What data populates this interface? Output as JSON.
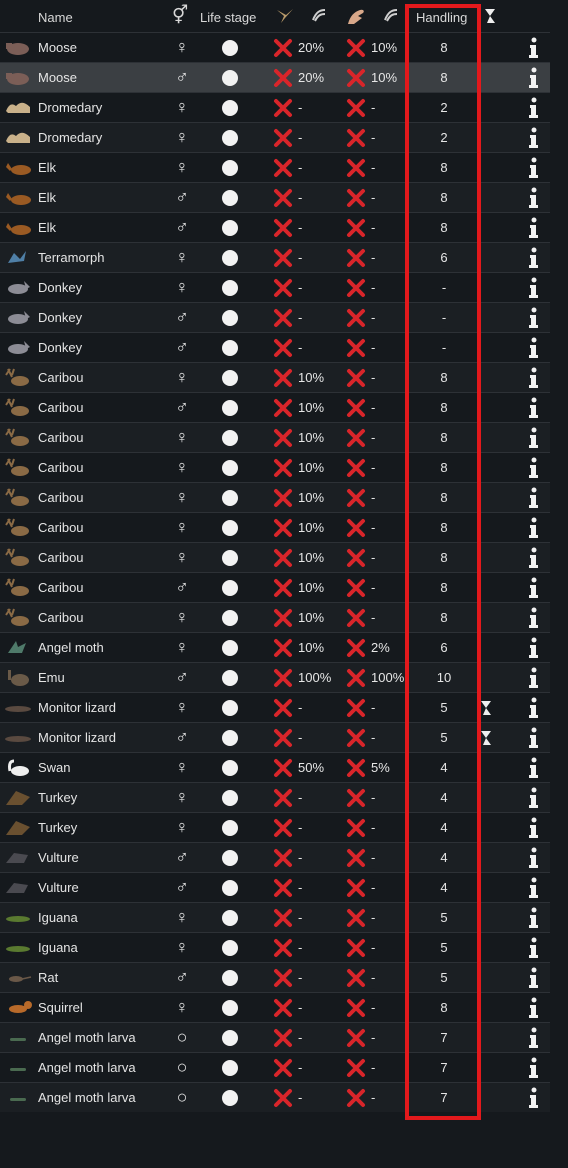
{
  "header": {
    "name": "Name",
    "gender_icon": "male-female-icon",
    "life_stage": "Life stage",
    "col1_icon": "pen-icon",
    "col1_sub_icon": "shearing-icon",
    "col2_icon": "hand-icon",
    "col2_sub_icon": "milking-icon",
    "handling": "Handling",
    "warn_icon": "bond-warning-icon"
  },
  "colors": {
    "x": "#d9252a",
    "highlight": "#e3191c",
    "selected_row": "#3b3f43"
  },
  "rows": [
    {
      "name": "Moose",
      "gender": "♀",
      "gender_icon": "female-icon",
      "life": "adult",
      "v1": "20%",
      "v2": "10%",
      "handling": "8",
      "warn": false,
      "animal": "moose-icon",
      "color": "#7b5e57"
    },
    {
      "name": "Moose",
      "gender": "♂",
      "gender_icon": "male-icon",
      "life": "adult",
      "v1": "20%",
      "v2": "10%",
      "handling": "8",
      "warn": false,
      "animal": "moose-icon",
      "color": "#7b5e57",
      "selected": true
    },
    {
      "name": "Dromedary",
      "gender": "♀",
      "gender_icon": "female-icon",
      "life": "adult",
      "v1": "-",
      "v2": "-",
      "handling": "2",
      "warn": false,
      "animal": "dromedary-icon",
      "color": "#c9b18a"
    },
    {
      "name": "Dromedary",
      "gender": "♀",
      "gender_icon": "female-icon",
      "life": "adult",
      "v1": "-",
      "v2": "-",
      "handling": "2",
      "warn": false,
      "animal": "dromedary-icon",
      "color": "#c9b18a"
    },
    {
      "name": "Elk",
      "gender": "♀",
      "gender_icon": "female-icon",
      "life": "adult",
      "v1": "-",
      "v2": "-",
      "handling": "8",
      "warn": false,
      "animal": "elk-icon",
      "color": "#9a5a23"
    },
    {
      "name": "Elk",
      "gender": "♂",
      "gender_icon": "male-icon",
      "life": "adult",
      "v1": "-",
      "v2": "-",
      "handling": "8",
      "warn": false,
      "animal": "elk-icon",
      "color": "#9a5a23"
    },
    {
      "name": "Elk",
      "gender": "♂",
      "gender_icon": "male-icon",
      "life": "adult",
      "v1": "-",
      "v2": "-",
      "handling": "8",
      "warn": false,
      "animal": "elk-icon",
      "color": "#9a5a23"
    },
    {
      "name": "Terramorph",
      "gender": "♀",
      "gender_icon": "female-icon",
      "life": "adult",
      "v1": "-",
      "v2": "-",
      "handling": "6",
      "warn": false,
      "animal": "terramorph-icon",
      "color": "#4f7fa6"
    },
    {
      "name": "Donkey",
      "gender": "♀",
      "gender_icon": "female-icon",
      "life": "adult",
      "v1": "-",
      "v2": "-",
      "handling": "-",
      "warn": false,
      "animal": "donkey-icon",
      "color": "#8c8c95"
    },
    {
      "name": "Donkey",
      "gender": "♂",
      "gender_icon": "male-icon",
      "life": "adult",
      "v1": "-",
      "v2": "-",
      "handling": "-",
      "warn": false,
      "animal": "donkey-icon",
      "color": "#8c8c95"
    },
    {
      "name": "Donkey",
      "gender": "♂",
      "gender_icon": "male-icon",
      "life": "adult",
      "v1": "-",
      "v2": "-",
      "handling": "-",
      "warn": false,
      "animal": "donkey-icon",
      "color": "#8c8c95"
    },
    {
      "name": "Caribou",
      "gender": "♀",
      "gender_icon": "female-icon",
      "life": "adult",
      "v1": "10%",
      "v2": "-",
      "handling": "8",
      "warn": false,
      "animal": "caribou-icon",
      "color": "#8a6a45"
    },
    {
      "name": "Caribou",
      "gender": "♂",
      "gender_icon": "male-icon",
      "life": "adult",
      "v1": "10%",
      "v2": "-",
      "handling": "8",
      "warn": false,
      "animal": "caribou-icon",
      "color": "#8a6a45"
    },
    {
      "name": "Caribou",
      "gender": "♀",
      "gender_icon": "female-icon",
      "life": "adult",
      "v1": "10%",
      "v2": "-",
      "handling": "8",
      "warn": false,
      "animal": "caribou-icon",
      "color": "#8a6a45"
    },
    {
      "name": "Caribou",
      "gender": "♀",
      "gender_icon": "female-icon",
      "life": "adult",
      "v1": "10%",
      "v2": "-",
      "handling": "8",
      "warn": false,
      "animal": "caribou-icon",
      "color": "#8a6a45"
    },
    {
      "name": "Caribou",
      "gender": "♀",
      "gender_icon": "female-icon",
      "life": "adult",
      "v1": "10%",
      "v2": "-",
      "handling": "8",
      "warn": false,
      "animal": "caribou-icon",
      "color": "#8a6a45"
    },
    {
      "name": "Caribou",
      "gender": "♀",
      "gender_icon": "female-icon",
      "life": "adult",
      "v1": "10%",
      "v2": "-",
      "handling": "8",
      "warn": false,
      "animal": "caribou-icon",
      "color": "#8a6a45"
    },
    {
      "name": "Caribou",
      "gender": "♀",
      "gender_icon": "female-icon",
      "life": "adult",
      "v1": "10%",
      "v2": "-",
      "handling": "8",
      "warn": false,
      "animal": "caribou-icon",
      "color": "#8a6a45"
    },
    {
      "name": "Caribou",
      "gender": "♂",
      "gender_icon": "male-icon",
      "life": "adult",
      "v1": "10%",
      "v2": "-",
      "handling": "8",
      "warn": false,
      "animal": "caribou-icon",
      "color": "#8a6a45"
    },
    {
      "name": "Caribou",
      "gender": "♀",
      "gender_icon": "female-icon",
      "life": "adult",
      "v1": "10%",
      "v2": "-",
      "handling": "8",
      "warn": false,
      "animal": "caribou-icon",
      "color": "#8a6a45"
    },
    {
      "name": "Angel moth",
      "gender": "♀",
      "gender_icon": "female-icon",
      "life": "adult",
      "v1": "10%",
      "v2": "2%",
      "handling": "6",
      "warn": false,
      "animal": "angel-moth-icon",
      "color": "#4f7a6a"
    },
    {
      "name": "Emu",
      "gender": "♂",
      "gender_icon": "male-icon",
      "life": "adult",
      "v1": "100%",
      "v2": "100%",
      "handling": "10",
      "warn": false,
      "animal": "emu-icon",
      "color": "#6a5a48"
    },
    {
      "name": "Monitor lizard",
      "gender": "♀",
      "gender_icon": "female-icon",
      "life": "adult",
      "v1": "-",
      "v2": "-",
      "handling": "5",
      "warn": true,
      "animal": "monitor-lizard-icon",
      "color": "#5a4a40"
    },
    {
      "name": "Monitor lizard",
      "gender": "♂",
      "gender_icon": "male-icon",
      "life": "adult",
      "v1": "-",
      "v2": "-",
      "handling": "5",
      "warn": true,
      "animal": "monitor-lizard-icon",
      "color": "#5a4a40"
    },
    {
      "name": "Swan",
      "gender": "♀",
      "gender_icon": "female-icon",
      "life": "adult",
      "v1": "50%",
      "v2": "5%",
      "handling": "4",
      "warn": false,
      "animal": "swan-icon",
      "color": "#eeeeee"
    },
    {
      "name": "Turkey",
      "gender": "♀",
      "gender_icon": "female-icon",
      "life": "adult",
      "v1": "-",
      "v2": "-",
      "handling": "4",
      "warn": false,
      "animal": "turkey-icon",
      "color": "#6a5030"
    },
    {
      "name": "Turkey",
      "gender": "♀",
      "gender_icon": "female-icon",
      "life": "adult",
      "v1": "-",
      "v2": "-",
      "handling": "4",
      "warn": false,
      "animal": "turkey-icon",
      "color": "#6a5030"
    },
    {
      "name": "Vulture",
      "gender": "♂",
      "gender_icon": "male-icon",
      "life": "adult",
      "v1": "-",
      "v2": "-",
      "handling": "4",
      "warn": false,
      "animal": "vulture-icon",
      "color": "#4a4a50"
    },
    {
      "name": "Vulture",
      "gender": "♂",
      "gender_icon": "male-icon",
      "life": "adult",
      "v1": "-",
      "v2": "-",
      "handling": "4",
      "warn": false,
      "animal": "vulture-icon",
      "color": "#4a4a50"
    },
    {
      "name": "Iguana",
      "gender": "♀",
      "gender_icon": "female-icon",
      "life": "adult",
      "v1": "-",
      "v2": "-",
      "handling": "5",
      "warn": false,
      "animal": "iguana-icon",
      "color": "#5a7a30"
    },
    {
      "name": "Iguana",
      "gender": "♀",
      "gender_icon": "female-icon",
      "life": "adult",
      "v1": "-",
      "v2": "-",
      "handling": "5",
      "warn": false,
      "animal": "iguana-icon",
      "color": "#5a7a30"
    },
    {
      "name": "Rat",
      "gender": "♂",
      "gender_icon": "male-icon",
      "life": "adult",
      "v1": "-",
      "v2": "-",
      "handling": "5",
      "warn": false,
      "animal": "rat-icon",
      "color": "#6a5848"
    },
    {
      "name": "Squirrel",
      "gender": "♀",
      "gender_icon": "female-icon",
      "life": "adult",
      "v1": "-",
      "v2": "-",
      "handling": "8",
      "warn": false,
      "animal": "squirrel-icon",
      "color": "#b86a2a"
    },
    {
      "name": "Angel moth larva",
      "gender": "○",
      "gender_icon": "genderless-icon",
      "life": "adult",
      "v1": "-",
      "v2": "-",
      "handling": "7",
      "warn": false,
      "animal": "larva-icon",
      "color": "#4a6a50"
    },
    {
      "name": "Angel moth larva",
      "gender": "○",
      "gender_icon": "genderless-icon",
      "life": "adult",
      "v1": "-",
      "v2": "-",
      "handling": "7",
      "warn": false,
      "animal": "larva-icon",
      "color": "#4a6a50"
    },
    {
      "name": "Angel moth larva",
      "gender": "○",
      "gender_icon": "genderless-icon",
      "life": "adult",
      "v1": "-",
      "v2": "-",
      "handling": "7",
      "warn": false,
      "animal": "larva-icon",
      "color": "#4a6a50"
    }
  ]
}
